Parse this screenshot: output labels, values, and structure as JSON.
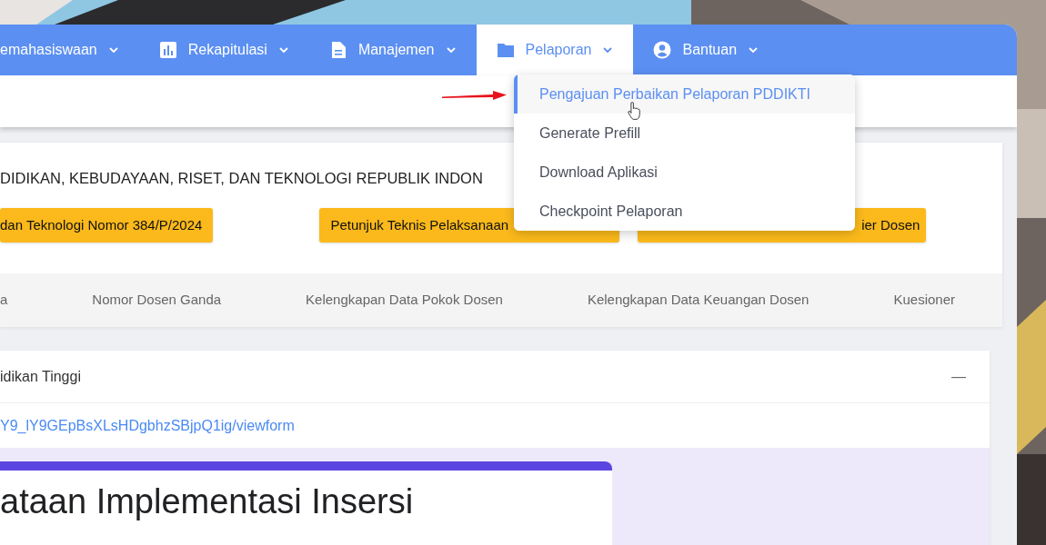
{
  "nav": [
    {
      "label": "emahasiswaan",
      "kind": "plain",
      "selected": false
    },
    {
      "label": "Rekapitulasi",
      "kind": "chart",
      "selected": false
    },
    {
      "label": "Manajemen",
      "kind": "document",
      "selected": false
    },
    {
      "label": "Pelaporan",
      "kind": "folder",
      "selected": true
    },
    {
      "label": "Bantuan",
      "kind": "user",
      "selected": false
    }
  ],
  "dropdown": [
    {
      "label": "Pengajuan Perbaikan Pelaporan PDDIKTI",
      "selected": true
    },
    {
      "label": "Generate Prefill",
      "selected": false
    },
    {
      "label": "Download Aplikasi",
      "selected": false
    },
    {
      "label": "Checkpoint Pelaporan",
      "selected": false
    }
  ],
  "announcement": {
    "title": "DIDIKAN, KEBUDAYAAN, RISET, DAN TEKNOLOGI REPUBLIK INDON",
    "buttons": [
      "dan Teknologi Nomor 384/P/2024",
      "Petunjuk Teknis Pelaksanaan",
      "ier Dosen"
    ]
  },
  "tabs": [
    {
      "label": "a"
    },
    {
      "label": "Nomor Dosen Ganda"
    },
    {
      "label": "Kelengkapan Data Pokok Dosen"
    },
    {
      "label": "Kelengkapan Data Keuangan Dosen"
    },
    {
      "label": "Kuesioner"
    }
  ],
  "panel": {
    "title": "idikan Tinggi",
    "collapse": "—",
    "link": "Y9_lY9GEpBsXLsHDgbhzSBjpQ1ig/viewform",
    "form_title": "ataan Implementasi Insersi"
  }
}
